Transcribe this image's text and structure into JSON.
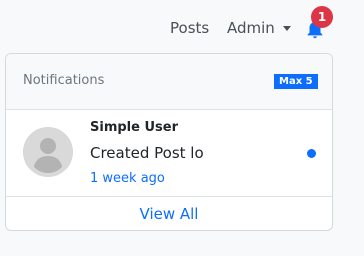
{
  "navbar": {
    "posts_label": "Posts",
    "admin_label": "Admin",
    "notification_count": "1"
  },
  "notifications": {
    "title": "Notifications",
    "max_badge": "Max 5",
    "items": [
      {
        "user": "Simple User",
        "message": "Created Post lo",
        "time": "1 week ago",
        "unread": true
      }
    ],
    "view_all_label": "View All"
  },
  "colors": {
    "primary": "#0d6efd",
    "badge_red": "#dc3545",
    "avatar_bg": "#d9d9d9"
  }
}
